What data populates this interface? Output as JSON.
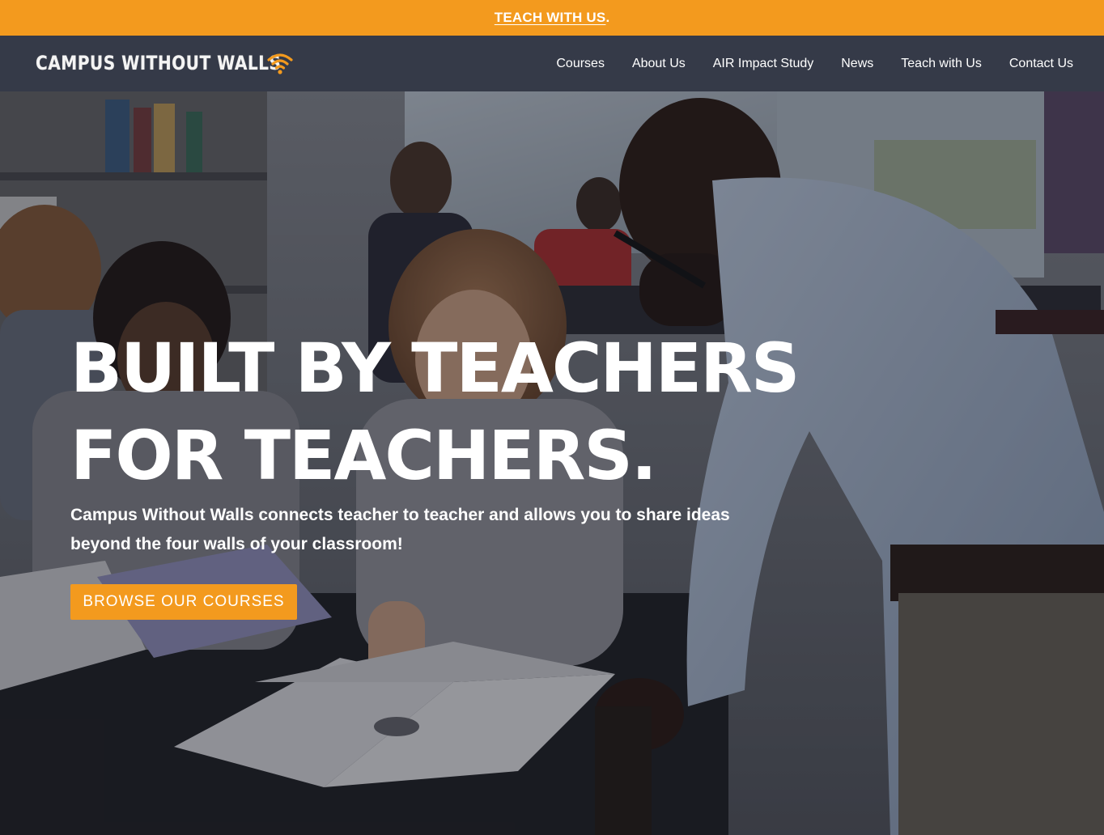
{
  "announcement": {
    "link_text": "TEACH WITH US",
    "suffix": "."
  },
  "brand": {
    "name": "CAMPUS WITHOUT WALLS",
    "icon": "wifi-signal-icon",
    "accent_color": "#f39a1e",
    "nav_background": "#353a48"
  },
  "nav": {
    "items": [
      {
        "label": "Courses"
      },
      {
        "label": "About Us"
      },
      {
        "label": "AIR Impact Study"
      },
      {
        "label": "News"
      },
      {
        "label": "Teach with Us"
      },
      {
        "label": "Contact Us"
      }
    ]
  },
  "hero": {
    "headline_line1": "BUILT BY TEACHERS",
    "headline_line2": "FOR TEACHERS.",
    "subtext": "Campus Without Walls connects teacher to teacher and allows you to share ideas beyond the four walls of your classroom!",
    "cta_label": "BROWSE OUR COURSES"
  }
}
